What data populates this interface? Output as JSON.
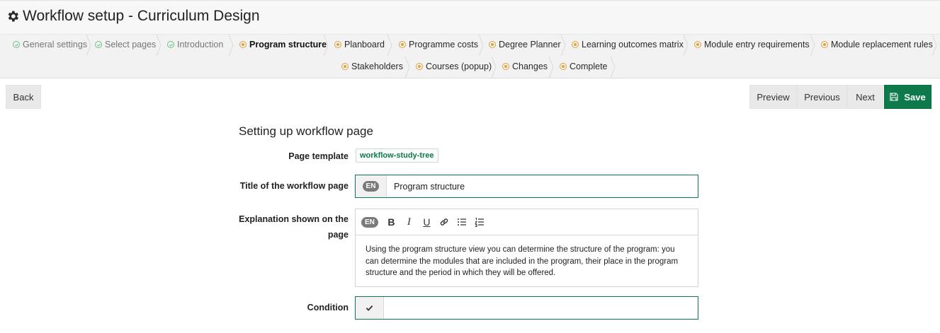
{
  "header": {
    "title": "Workflow setup - Curriculum Design",
    "icon": "gear-icon"
  },
  "steps": [
    {
      "label": "General settings",
      "status": "done"
    },
    {
      "label": "Select pages",
      "status": "done"
    },
    {
      "label": "Introduction",
      "status": "done"
    },
    {
      "label": "Program structure",
      "status": "current"
    },
    {
      "label": "Planboard",
      "status": "todo"
    },
    {
      "label": "Programme costs",
      "status": "todo"
    },
    {
      "label": "Degree Planner",
      "status": "todo"
    },
    {
      "label": "Learning outcomes matrix",
      "status": "todo"
    },
    {
      "label": "Module entry requirements",
      "status": "todo"
    },
    {
      "label": "Module replacement rules",
      "status": "todo"
    },
    {
      "label": "Stakeholders",
      "status": "todo"
    },
    {
      "label": "Courses (popup)",
      "status": "todo"
    },
    {
      "label": "Changes",
      "status": "todo"
    },
    {
      "label": "Complete",
      "status": "todo"
    }
  ],
  "actions": {
    "back": "Back",
    "preview": "Preview",
    "previous": "Previous",
    "next": "Next",
    "save": "Save"
  },
  "form": {
    "section_title": "Setting up workflow page",
    "page_template_label": "Page template",
    "page_template_value": "workflow-study-tree",
    "title_label": "Title of the workflow page",
    "title_lang": "EN",
    "title_value": "Program structure",
    "explanation_label_line1": "Explanation shown on the",
    "explanation_label_line2": "page",
    "explanation_lang": "EN",
    "explanation_toolbar": [
      "bold-icon",
      "italic-icon",
      "underline-icon",
      "link-icon",
      "bullet-list-icon",
      "numbered-list-icon"
    ],
    "explanation_text": "Using the program structure view you can determine the structure of the program: you can determine the modules that are included in the program, their place in the program structure and the period in which they will be offered.",
    "condition_label": "Condition",
    "condition_value": ""
  },
  "colors": {
    "accent": "#0e7a4b",
    "done": "#6bbf86",
    "todo": "#e0a23a"
  }
}
